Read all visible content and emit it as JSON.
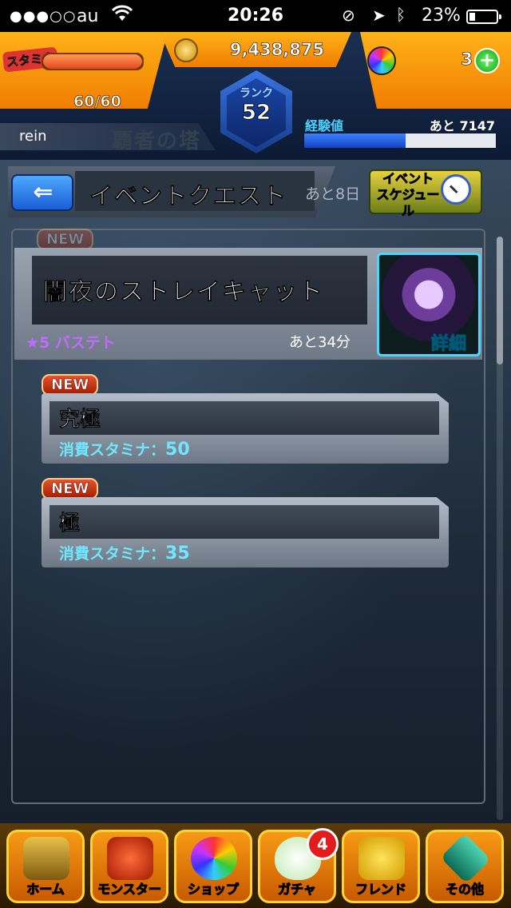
{
  "status_bar": {
    "signal": "●●●○○",
    "carrier": "au",
    "time": "20:26",
    "battery_percent": "23%",
    "battery_level": 0.23
  },
  "hud": {
    "stamina_label": "スタミナ",
    "stamina_text": "60/60",
    "stamina_fraction": 1.0,
    "coins": "9,438,875",
    "orbs": "3",
    "plus_symbol": "+",
    "rank_label": "ランク",
    "rank_value": "52",
    "player_name": "rein",
    "background_title": "覇者の塔",
    "exp_label": "経験値",
    "exp_remaining": "あと 7147",
    "exp_fraction": 0.53
  },
  "header": {
    "title": "イベントクエスト",
    "remaining": "あと8日",
    "schedule_label": "イベント\nスケジュール"
  },
  "featured_quest": {
    "badge": "NEW",
    "title": "闇夜のストレイキャット",
    "boss": "★5 バステト",
    "time_remaining": "あと34分",
    "detail_label": "詳細"
  },
  "quests": [
    {
      "badge": "NEW",
      "name": "究極",
      "stamina_label": "消費スタミナ：",
      "stamina_value": "50"
    },
    {
      "badge": "NEW",
      "name": "極",
      "stamina_label": "消費スタミナ：",
      "stamina_value": "35"
    }
  ],
  "bottom_nav": {
    "items": [
      {
        "label": "ホーム",
        "icon": "home-gate-icon"
      },
      {
        "label": "モンスター",
        "icon": "monster-dragon-icon"
      },
      {
        "label": "ショップ",
        "icon": "rainbow-orb-icon"
      },
      {
        "label": "ガチャ",
        "icon": "egg-icon"
      },
      {
        "label": "フレンド",
        "icon": "friends-icon"
      },
      {
        "label": "その他",
        "icon": "map-signpost-icon"
      }
    ],
    "gacha_badge": "4"
  },
  "colors": {
    "accent_orange": "#f79a15",
    "exp_blue": "#1e5fd6",
    "stamina_red": "#e2481c",
    "boss_purple": "#c06bff",
    "stamina_cost_cyan": "#6ee7ff"
  }
}
